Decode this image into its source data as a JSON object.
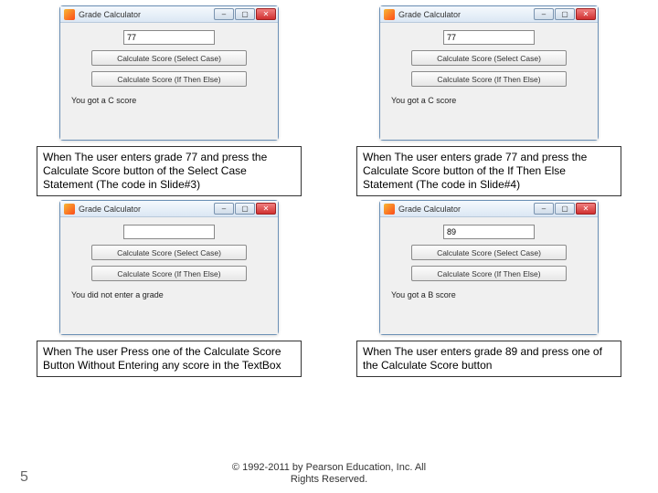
{
  "window_title": "Grade Calculator",
  "button1_label": "Calculate Score (Select Case)",
  "button2_label": "Calculate Score (If Then Else)",
  "quadrants": [
    {
      "input_value": "77",
      "result_text": "You got a C score",
      "caption": "When The user enters grade 77 and press the Calculate Score button of the Select Case Statement (The code in Slide#3)"
    },
    {
      "input_value": "77",
      "result_text": "You got a C score",
      "caption": "When The user enters grade 77 and press the Calculate Score button of the If Then Else Statement (The code in Slide#4)"
    },
    {
      "input_value": "",
      "result_text": "You did not enter a grade",
      "caption": "When The user Press one of the Calculate Score Button Without Entering any score in the TextBox"
    },
    {
      "input_value": "89",
      "result_text": "You got a B score",
      "caption": "When The user enters grade 89 and press one of the Calculate Score button"
    }
  ],
  "slide_number": "5",
  "copyright_line1": "© 1992-2011 by Pearson Education, Inc. All",
  "copyright_line2": "Rights Reserved."
}
